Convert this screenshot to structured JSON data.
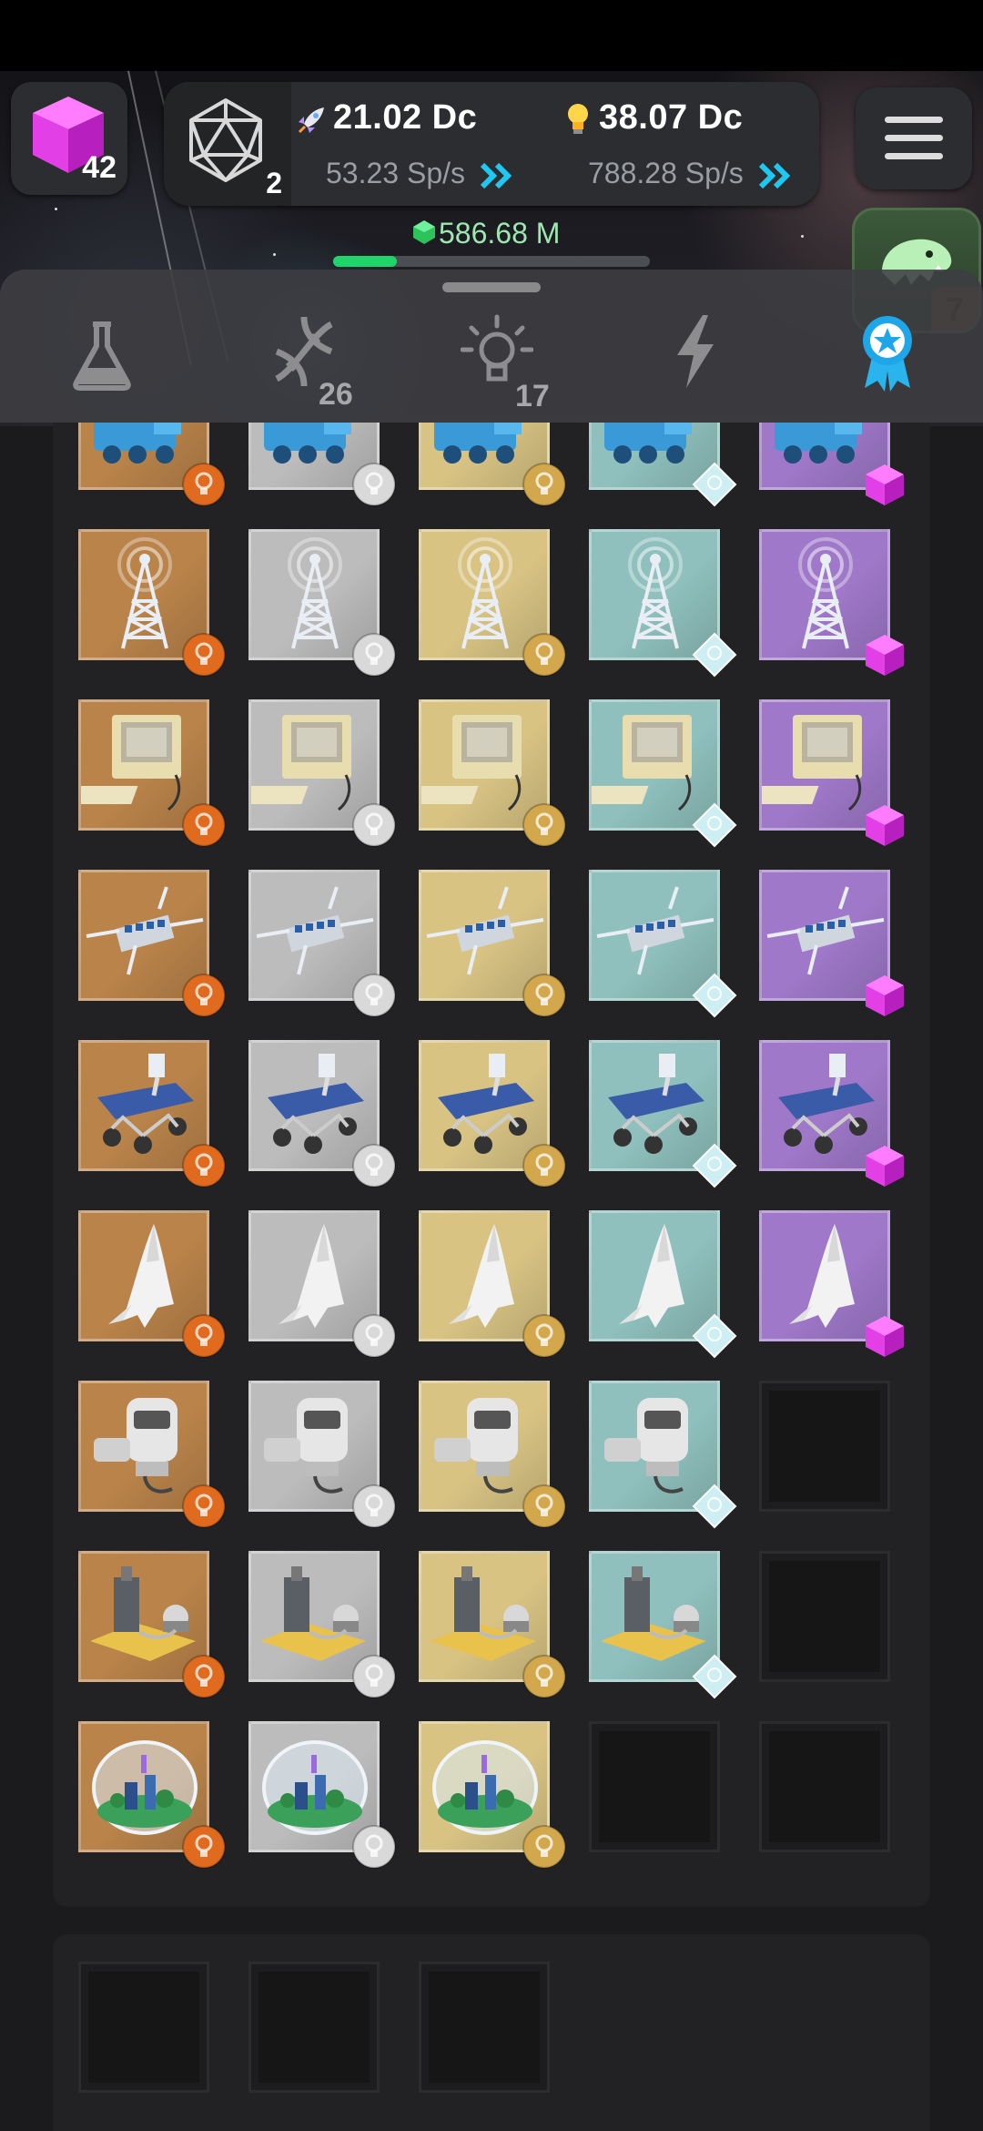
{
  "topbar": {
    "cube_count": "42",
    "d20_count": "2",
    "rocket_value": "21.02 Dc",
    "rocket_rate": "53.23 Sp/s",
    "bulb_value": "38.07 Dc",
    "bulb_rate": "788.28 Sp/s",
    "gem_value": "586.68 M",
    "gem_progress_fraction": 0.2,
    "dino_level": "7"
  },
  "tabs": [
    {
      "icon": "flask-icon",
      "count": ""
    },
    {
      "icon": "dna-icon",
      "count": "26"
    },
    {
      "icon": "lightbulb-icon",
      "count": "17"
    },
    {
      "icon": "lightning-icon",
      "count": ""
    },
    {
      "icon": "award-ribbon-icon",
      "count": "",
      "active": true
    }
  ],
  "tiers": [
    {
      "name": "bronze",
      "bg": "#b9834a",
      "badge": "#e06a1e"
    },
    {
      "name": "silver",
      "bg": "#bdbcbc",
      "badge": "#d9d9d9"
    },
    {
      "name": "gold",
      "bg": "#d8c383",
      "badge": "#d3a74b"
    },
    {
      "name": "diamond",
      "bg": "#8fc0bd",
      "badge": "#bfe9ef"
    },
    {
      "name": "amethyst",
      "bg": "#9f78c9",
      "badge": "#d04ad8"
    }
  ],
  "rows": [
    {
      "item": "locomotive-icon",
      "unlocked": 5
    },
    {
      "item": "radio-tower-icon",
      "unlocked": 5
    },
    {
      "item": "computer-icon",
      "unlocked": 5
    },
    {
      "item": "satellite-icon",
      "unlocked": 5
    },
    {
      "item": "rover-icon",
      "unlocked": 5
    },
    {
      "item": "space-shuttle-icon",
      "unlocked": 5
    },
    {
      "item": "robot-head-icon",
      "unlocked": 4
    },
    {
      "item": "base-station-icon",
      "unlocked": 4
    },
    {
      "item": "biodome-icon",
      "unlocked": 3
    }
  ],
  "bottom_slots": 3
}
